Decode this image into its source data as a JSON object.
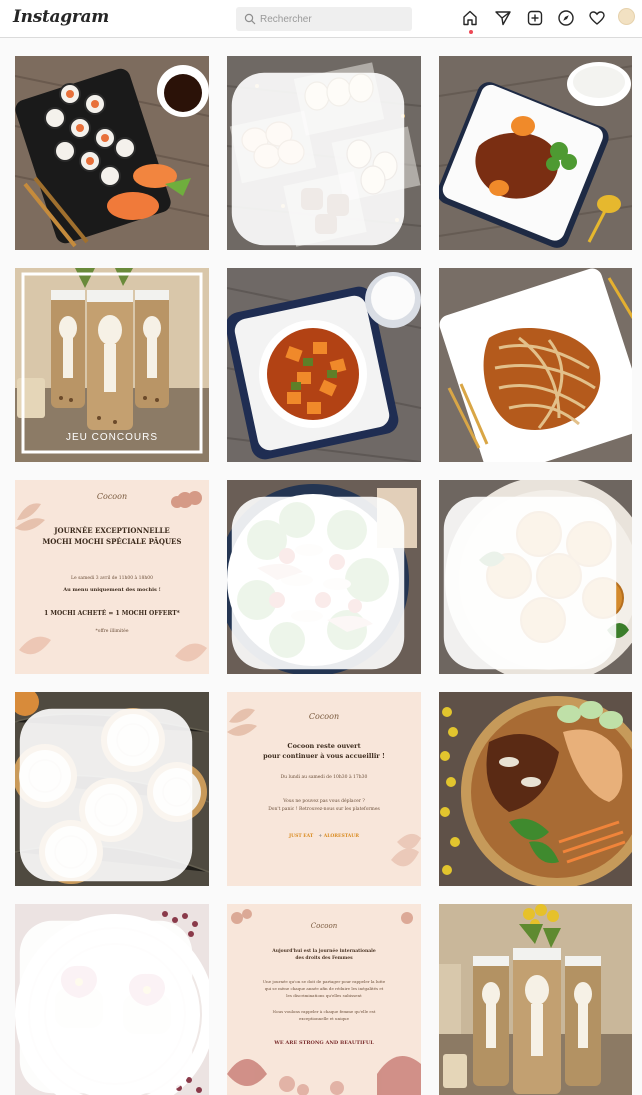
{
  "header": {
    "logo_text": "Instagram",
    "search_placeholder": "Rechercher",
    "nav_icons": [
      "home-icon",
      "direct-icon",
      "new-post-icon",
      "explore-icon",
      "activity-icon"
    ]
  },
  "colors": {
    "notification_dot": "#ed4956",
    "poster_bg": "#f8e6da",
    "poster_accent": "#c98a6a"
  },
  "posts": [
    {
      "id": 1,
      "kind": "photo",
      "subject": "sushi-rolls"
    },
    {
      "id": 2,
      "kind": "photo",
      "subject": "panda-mochi-boxes",
      "multi": true
    },
    {
      "id": 3,
      "kind": "photo",
      "subject": "beef-stew-plate"
    },
    {
      "id": 4,
      "kind": "photo",
      "subject": "bubble-tea-bottles",
      "caption": "JEU CONCOURS"
    },
    {
      "id": 5,
      "kind": "photo",
      "subject": "vegetable-curry-bowl"
    },
    {
      "id": 6,
      "kind": "photo",
      "subject": "stir-fried-noodles"
    },
    {
      "id": 7,
      "kind": "poster",
      "brand": "Cocoon",
      "title_1": "JOURNÉE EXCEPTIONNELLE",
      "title_2": "MOCHI MOCHI SPÉCIALE PÂQUES",
      "line_1": "Le samedi 3 avril de 11h00 à 18h00",
      "line_2": "Au menu uniquement des mochis !",
      "line_3": "1 MOCHI ACHETÉ = 1 MOCHI OFFERT*",
      "line_4": "*offre illimitée"
    },
    {
      "id": 8,
      "kind": "photo",
      "subject": "salad-bowl",
      "multi": true
    },
    {
      "id": 9,
      "kind": "photo",
      "subject": "fried-balls-plate",
      "multi": true
    },
    {
      "id": 10,
      "kind": "photo",
      "subject": "mooncakes",
      "multi": true
    },
    {
      "id": 11,
      "kind": "poster",
      "brand": "Cocoon",
      "title_1": "Cocoon reste ouvert",
      "title_2": "pour continuer à vous accueillir !",
      "line_1": "Du lundi au samedi de 10h30 à 17h30",
      "line_2": "Vous ne pouvez pas vous déplacer ?",
      "line_3": "Don't panic ! Retrouvez-nous sur les plateformes",
      "partner_1": "JUST EAT",
      "partner_2": "ALORESTAUR"
    },
    {
      "id": 12,
      "kind": "photo",
      "subject": "bulgogi-bowl"
    },
    {
      "id": 13,
      "kind": "photo",
      "subject": "flower-mochi",
      "multi": true
    },
    {
      "id": 14,
      "kind": "poster",
      "brand": "Cocoon",
      "title_1": "Aujourd'hui est la journée internationale",
      "title_2": "des droits des Femmes",
      "line_1": "Une journée qu'on se doit de partager pour rappeler la lutte",
      "line_2": "qui se mène chaque année afin de réduire les inégalités et",
      "line_3": "les discriminations qu'elles subissent",
      "line_4": "Nous voulons rappeler à chaque femme qu'elle est",
      "line_5": "exceptionnelle et unique",
      "closing": "WE ARE STRONG AND BEAUTIFUL"
    },
    {
      "id": 15,
      "kind": "photo",
      "subject": "bubble-tea-bottles-2"
    }
  ]
}
